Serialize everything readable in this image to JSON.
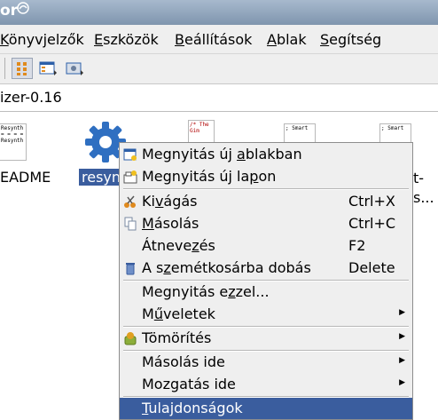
{
  "window": {
    "title": "or"
  },
  "menubar": [
    {
      "pre": "",
      "acc": "K",
      "post": "önyvjelzők"
    },
    {
      "pre": "",
      "acc": "E",
      "post": "szközök"
    },
    {
      "pre": "",
      "acc": "B",
      "post": "eállítások"
    },
    {
      "pre": "",
      "acc": "A",
      "post": "blak"
    },
    {
      "pre": "",
      "acc": "S",
      "post": "egítség"
    }
  ],
  "location": {
    "path": "izer-0.16"
  },
  "files": [
    {
      "label": "EADME",
      "thumb_text": "Resynth\n= = = =\nResynth"
    },
    {
      "label": "resyn",
      "thumb_text": ""
    },
    {
      "label": "",
      "thumb_text": "/*\n The\n Gim"
    },
    {
      "label": "",
      "thumb_text": "; Smart"
    },
    {
      "label": "t-\ns...",
      "thumb_text": "; Smart"
    }
  ],
  "context_menu": {
    "items": [
      {
        "pre": "Megnyitás új ",
        "acc": "a",
        "post": "blakban",
        "shortcut": "",
        "icon": "new-window-icon",
        "arrow": false
      },
      {
        "pre": "Megnyitás új la",
        "acc": "p",
        "post": "on",
        "shortcut": "",
        "icon": "new-tab-icon",
        "arrow": false
      },
      {
        "pre": "Ki",
        "acc": "v",
        "post": "ágás",
        "shortcut": "Ctrl+X",
        "icon": "cut-icon",
        "arrow": false
      },
      {
        "pre": "",
        "acc": "M",
        "post": "ásolás",
        "shortcut": "Ctrl+C",
        "icon": "copy-icon",
        "arrow": false
      },
      {
        "pre": "Átneve",
        "acc": "z",
        "post": "és",
        "shortcut": "F2",
        "icon": "",
        "arrow": false
      },
      {
        "pre": "A s",
        "acc": "z",
        "post": "emétkosárba dobás",
        "shortcut": "Delete",
        "icon": "trash-icon",
        "arrow": false
      },
      {
        "pre": "Megnyitás e",
        "acc": "z",
        "post": "zel...",
        "shortcut": "",
        "icon": "",
        "arrow": false
      },
      {
        "pre": "M",
        "acc": "ű",
        "post": "veletek",
        "shortcut": "",
        "icon": "",
        "arrow": true
      },
      {
        "pre": "Tömörítés",
        "acc": "",
        "post": "",
        "shortcut": "",
        "icon": "compress-icon",
        "arrow": true
      },
      {
        "pre": "Másolás ide",
        "acc": "",
        "post": "",
        "shortcut": "",
        "icon": "",
        "arrow": true
      },
      {
        "pre": "Mozgatás ide",
        "acc": "",
        "post": "",
        "shortcut": "",
        "icon": "",
        "arrow": true
      },
      {
        "pre": "",
        "acc": "T",
        "post": "ulajdonságok",
        "shortcut": "",
        "icon": "",
        "arrow": false
      }
    ]
  },
  "colors": {
    "selection": "#3a5d9e",
    "menu_bg": "#efefef",
    "titlebar": "#8fa3bb"
  }
}
